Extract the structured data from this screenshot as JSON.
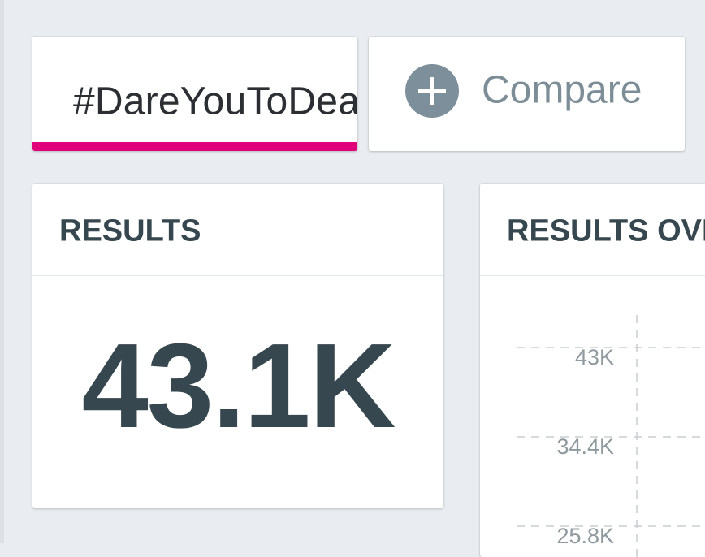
{
  "tabs": {
    "active_label": "#DareYouToDeathChallenge",
    "compare_label": "Compare",
    "accent_color": "#e0007a",
    "compare_icon": "plus-circle-icon"
  },
  "results_card": {
    "title": "RESULTS",
    "value": "43.1K"
  },
  "results_over_time_card": {
    "title": "RESULTS OVER TIME",
    "chart_data": {
      "type": "line",
      "title": "",
      "y_ticks": [
        "43K",
        "34.4K",
        "25.8K"
      ],
      "grid": true
    }
  }
}
